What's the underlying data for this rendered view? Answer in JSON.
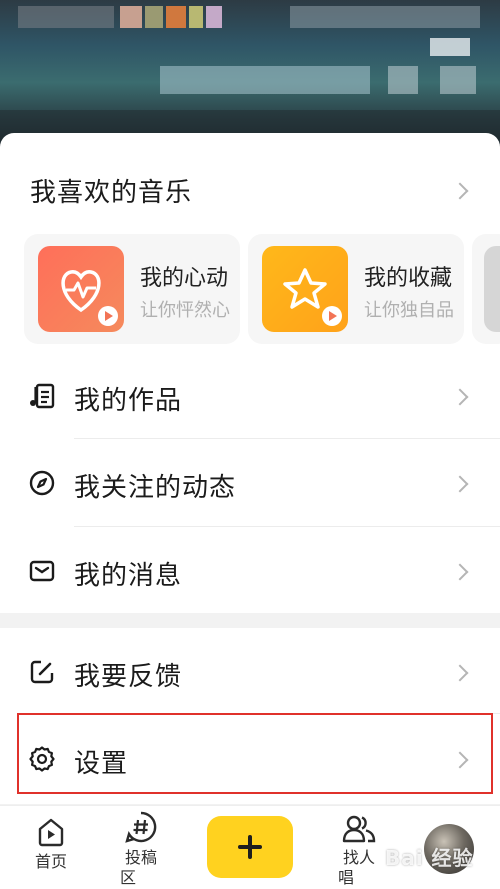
{
  "music_section": {
    "title": "我喜欢的音乐",
    "tiles": [
      {
        "title": "我的心动",
        "subtitle": "让你怦然心",
        "icon": "heartbeat-icon",
        "color_start": "#ff6f5a",
        "color_end": "#f58a5c"
      },
      {
        "title": "我的收藏",
        "subtitle": "让你独自品",
        "icon": "star-icon",
        "color_start": "#ffb81a",
        "color_end": "#ffa21a"
      }
    ]
  },
  "menu": {
    "works": "我的作品",
    "following": "我关注的动态",
    "messages": "我的消息",
    "feedback": "我要反馈",
    "settings": "设置"
  },
  "tabbar": {
    "home": "首页",
    "submit_line1": "投稿",
    "submit_line2": "区",
    "find_line1": "找人",
    "find_line2": "唱"
  },
  "watermark": "Bai 经验",
  "colors": {
    "accent": "#ffd21f",
    "highlight": "#e0312b"
  }
}
